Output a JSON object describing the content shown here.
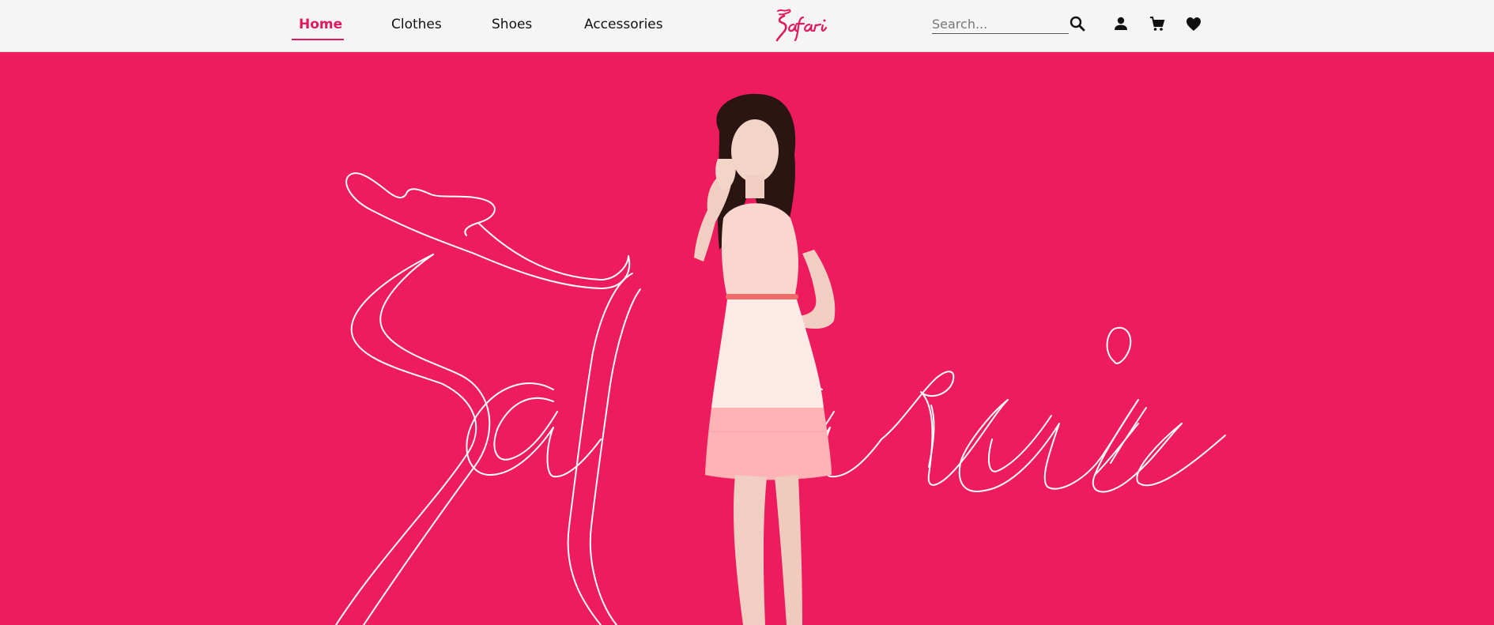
{
  "header": {
    "nav": [
      {
        "label": "Home",
        "active": true
      },
      {
        "label": "Clothes",
        "active": false
      },
      {
        "label": "Shoes",
        "active": false
      },
      {
        "label": "Accessories",
        "active": false
      }
    ],
    "logo_text": "Safari",
    "search": {
      "placeholder": "Search...",
      "value": ""
    },
    "icons": [
      "search-icon",
      "user-icon",
      "cart-icon",
      "heart-icon"
    ]
  },
  "hero": {
    "script_text": "Safari",
    "background_color": "#ee1b5e",
    "outline_color": "#ffffff"
  },
  "colors": {
    "accent": "#e0195c",
    "header_bg": "#f5f5f5",
    "text": "#111111"
  }
}
